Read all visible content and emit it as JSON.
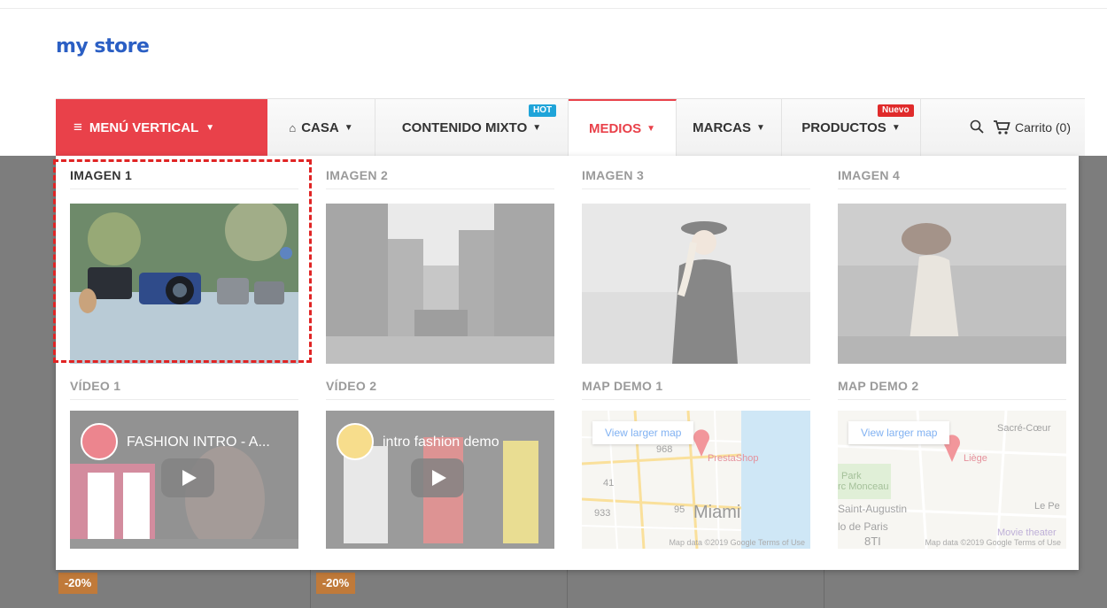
{
  "store": {
    "logo_text": "my store"
  },
  "nav": {
    "vertical_menu": "MENÚ VERTICAL",
    "items": [
      {
        "label": "CASA",
        "icon": "home-icon"
      },
      {
        "label": "CONTENIDO MIXTO",
        "badge": "HOT"
      },
      {
        "label": "MEDIOS",
        "active": true
      },
      {
        "label": "MARCAS"
      },
      {
        "label": "PRODUCTOS",
        "badge": "Nuevo"
      }
    ],
    "cart_label": "Carrito (0)",
    "accent_color": "#e9414a"
  },
  "dropdown": {
    "images": [
      {
        "title": "IMAGEN 1"
      },
      {
        "title": "IMAGEN 2"
      },
      {
        "title": "IMAGEN 3"
      },
      {
        "title": "IMAGEN 4"
      }
    ],
    "videos": [
      {
        "title": "VÍDEO 1",
        "video_title": "FASHION INTRO - A..."
      },
      {
        "title": "VÍDEO 2",
        "video_title": "intro fashion demo"
      }
    ],
    "maps": [
      {
        "title": "MAP DEMO 1",
        "link": "View larger map",
        "place": "PrestaShop",
        "city": "Miami",
        "road_a": "968",
        "road_b": "41",
        "road_c": "933",
        "road_d": "95",
        "footer": "Map data ©2019 Google   Terms of Use"
      },
      {
        "title": "MAP DEMO 2",
        "link": "View larger map",
        "place": "Liège",
        "labels": [
          "Sacré-Cœur",
          "Park",
          "rc Monceau",
          "Saint-Augustin",
          "Le Pe",
          "lo de Paris",
          "8TI",
          "Movie theater"
        ],
        "footer": "Map data ©2019 Google   Terms of Use"
      }
    ]
  },
  "products": {
    "discounts": [
      "-20%",
      "-20%"
    ]
  }
}
